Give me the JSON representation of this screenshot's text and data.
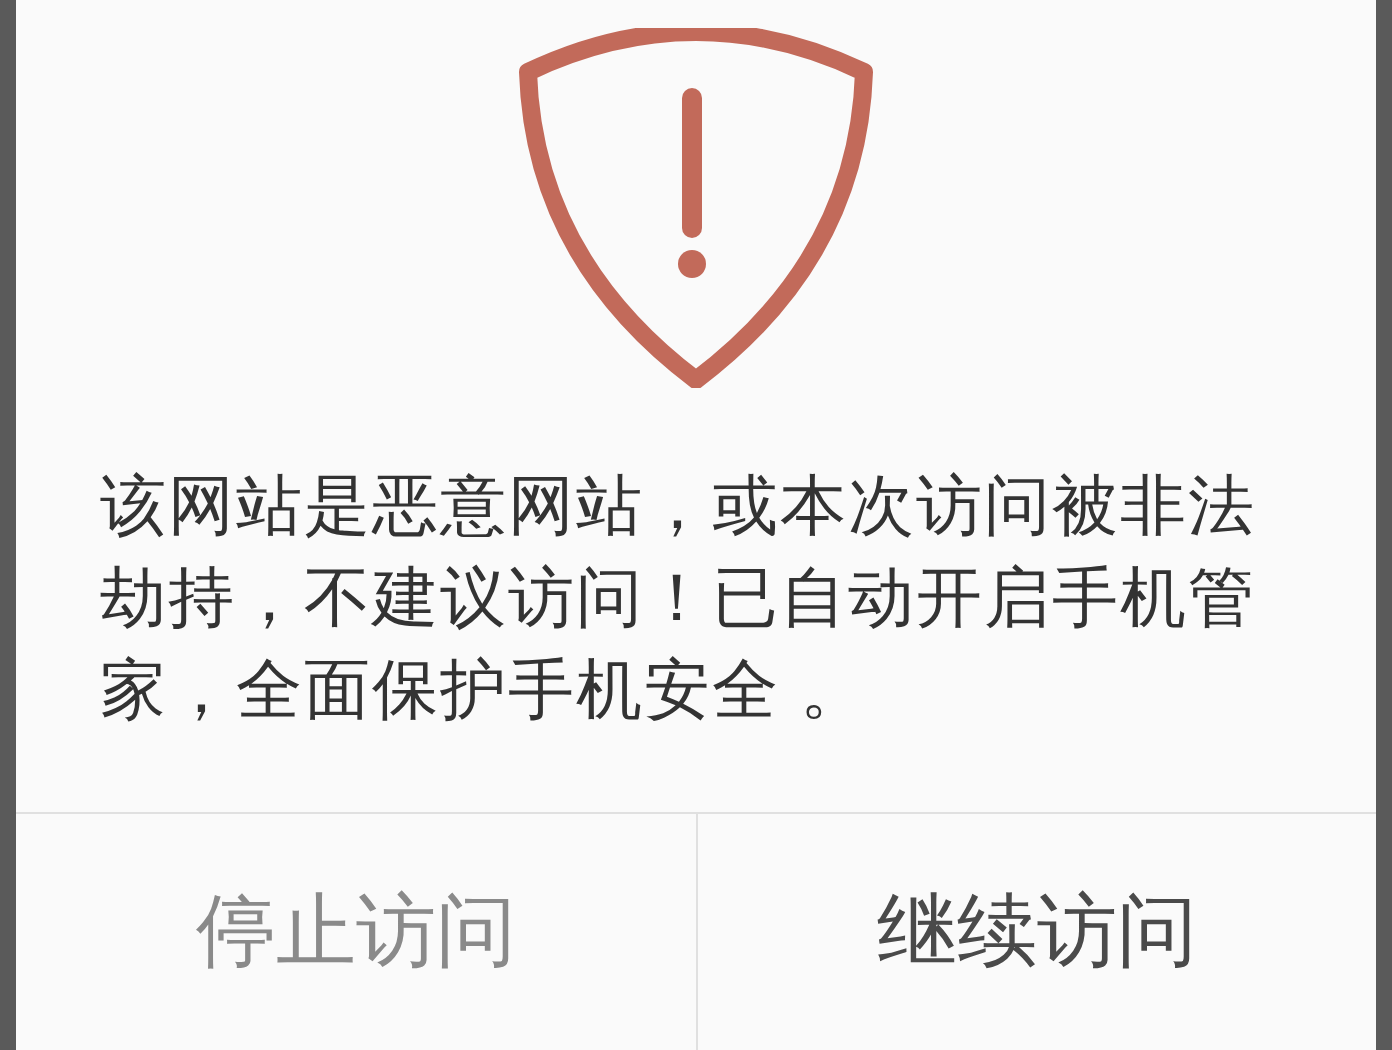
{
  "dialog": {
    "message": "该网站是恶意网站，或本次访问被非法劫持，不建议访问！已自动开启手机管家，全面保护手机安全 。",
    "buttons": [
      {
        "label": "停止访问",
        "kind": "secondary"
      },
      {
        "label": "继续访问",
        "kind": "primary"
      }
    ]
  }
}
